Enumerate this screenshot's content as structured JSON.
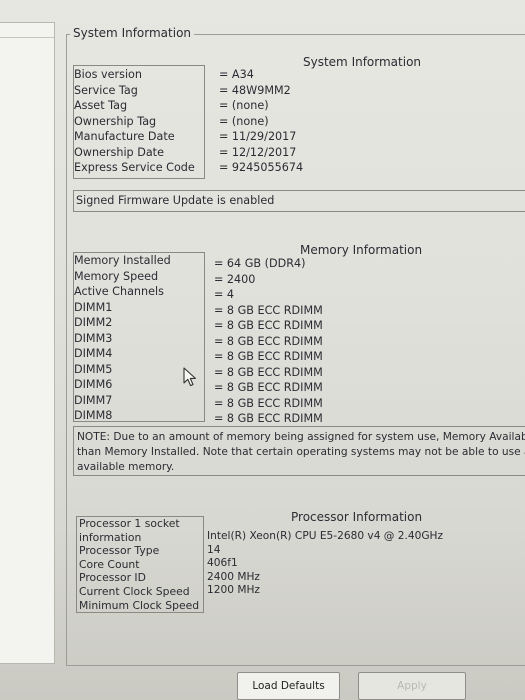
{
  "panel_title": "System Information",
  "system": {
    "heading": "System Information",
    "rows": [
      {
        "label": "Bios version",
        "value": "= A34"
      },
      {
        "label": "Service Tag",
        "value": "= 48W9MM2"
      },
      {
        "label": "Asset Tag",
        "value": "= (none)"
      },
      {
        "label": "Ownership Tag",
        "value": "= (none)"
      },
      {
        "label": "Manufacture Date",
        "value": "= 11/29/2017"
      },
      {
        "label": "Ownership Date",
        "value": "= 12/12/2017"
      },
      {
        "label": "Express Service Code",
        "value": "= 9245055674"
      }
    ],
    "firmware_note": "Signed Firmware Update is enabled"
  },
  "memory": {
    "heading": "Memory Information",
    "rows": [
      {
        "label": "Memory Installed",
        "value": "= 64 GB (DDR4)"
      },
      {
        "label": "Memory Speed",
        "value": "= 2400"
      },
      {
        "label": "Active Channels",
        "value": "= 4"
      },
      {
        "label": "DIMM1",
        "value": "= 8 GB ECC RDIMM"
      },
      {
        "label": "DIMM2",
        "value": "= 8 GB ECC RDIMM"
      },
      {
        "label": "DIMM3",
        "value": "= 8 GB ECC RDIMM"
      },
      {
        "label": "DIMM4",
        "value": "= 8 GB ECC RDIMM"
      },
      {
        "label": "DIMM5",
        "value": "= 8 GB ECC RDIMM"
      },
      {
        "label": "DIMM6",
        "value": "= 8 GB ECC RDIMM"
      },
      {
        "label": "DIMM7",
        "value": "= 8 GB ECC RDIMM"
      },
      {
        "label": "DIMM8",
        "value": "= 8 GB ECC RDIMM"
      }
    ],
    "note_lines": [
      "NOTE: Due to an amount of memory being assigned for system use, Memory Available is l",
      "than Memory Installed. Note that certain operating systems may not be able to use all the",
      "available memory."
    ]
  },
  "processor": {
    "heading": "Processor Information",
    "rows": [
      {
        "label": "Processor 1 socket information",
        "value": ""
      },
      {
        "label": "Processor Type",
        "value": "Intel(R) Xeon(R) CPU E5-2680 v4 @ 2.40GHz"
      },
      {
        "label": "Core Count",
        "value": "14"
      },
      {
        "label": "Processor ID",
        "value": "406f1"
      },
      {
        "label": "Current Clock Speed",
        "value": "2400 MHz"
      },
      {
        "label": "Minimum Clock Speed",
        "value": "1200 MHz"
      }
    ]
  },
  "buttons": {
    "load_defaults": "Load Defaults",
    "apply": "Apply"
  },
  "icons": {
    "cursor": "mouse-pointer-icon"
  },
  "colors": {
    "background": "#e3e3de",
    "text": "#2b2b33",
    "border": "#8a8a84",
    "disabled_text": "#b9b9b2"
  }
}
